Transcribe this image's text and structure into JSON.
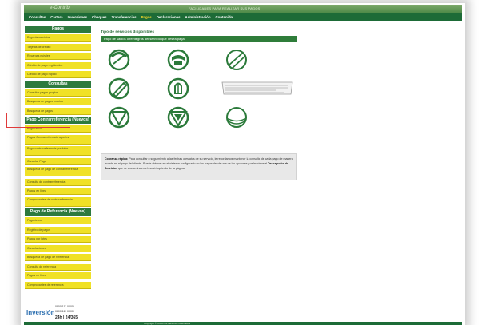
{
  "header": {
    "logo": "e-Contrib",
    "message": "FACILIDADES PARA REALIZAR SUS PAGOS"
  },
  "nav": [
    {
      "label": "Consultas",
      "active": false
    },
    {
      "label": "Cartera",
      "active": false
    },
    {
      "label": "Inversiones",
      "active": false
    },
    {
      "label": "Cheques",
      "active": false
    },
    {
      "label": "Transferencias",
      "active": false
    },
    {
      "label": "Pagos",
      "active": true
    },
    {
      "label": "Declaraciones",
      "active": false
    },
    {
      "label": "Administración",
      "active": false
    },
    {
      "label": "Contenido",
      "active": false
    }
  ],
  "sidebar": {
    "sections": [
      {
        "title": "Pagos",
        "items": [
          "Pago de servicios",
          "Tarjetas de crédito",
          "Recargas móviles",
          "Crédito de pago registrados",
          "Crédito de pago rápido"
        ]
      },
      {
        "title": "Consultas",
        "items": [
          "Consultar pagos propios",
          "Búsqueda de pagos propios",
          "Búsqueda de pagos"
        ]
      },
      {
        "title": "Pago Contrarreferencia (Nuevos)",
        "items": [
          "Pago único",
          "Pagos Contrarreferencia aportes",
          "Pago contrarreferencia por lotes",
          "Cancelar Pago",
          "Búsqueda de pago de contrarreferencia",
          "Consulta de contrarreferencia",
          "Pagos en línea",
          "Comprobantes de contrarreferencia"
        ]
      },
      {
        "title": "Pago de Referencia (Nuevos)",
        "items": [
          "Pago único",
          "Registro de pagos",
          "Pagos por lotes",
          "Cancelaciones",
          "Búsqueda de pago de referencia",
          "Consulta de referencia",
          "Pagos en línea",
          "Comprobantes de referencia"
        ]
      }
    ],
    "footer": {
      "brand": "Inversión",
      "line1": "0800 111 0000",
      "line2": "0800 111 0000",
      "hours": "24h | 24/365"
    }
  },
  "main": {
    "title": "Tipo de servicios disponibles",
    "section_label": "Pago de saldos o reintegros del servicio que desea pagar",
    "icons": [
      {
        "name": "agua-icon"
      },
      {
        "name": "telefono-icon"
      },
      {
        "name": "electricidad-icon"
      },
      {
        "name": "gas-icon"
      },
      {
        "name": "impuestos-icon"
      },
      {
        "name": "formulario-icon"
      },
      {
        "name": "seguros-icon"
      },
      {
        "name": "tributos-icon"
      },
      {
        "name": "internet-icon"
      }
    ],
    "info": {
      "lead": "Cobranza rápida:",
      "text": "Para consultar o seguimiento a las fechas o estatus de su servicio, le recordamos mantener la consulta de cada pago de manera acorde en el pago del cliente. Puede obtener en el sistema configurado en los pagos desde una de las opciones y seleccione el",
      "strong": "Descripción de Servicios",
      "tail": "que se encuentra en el menú izquierdo de la página."
    }
  },
  "bottombar": {
    "text": "Copyright © Todos los derechos reservados"
  },
  "colors": {
    "nav": "#1d6b37",
    "sidebar_item": "#f0e126",
    "section_bar": "#2f7d3a",
    "highlight": "#e03a3a"
  }
}
